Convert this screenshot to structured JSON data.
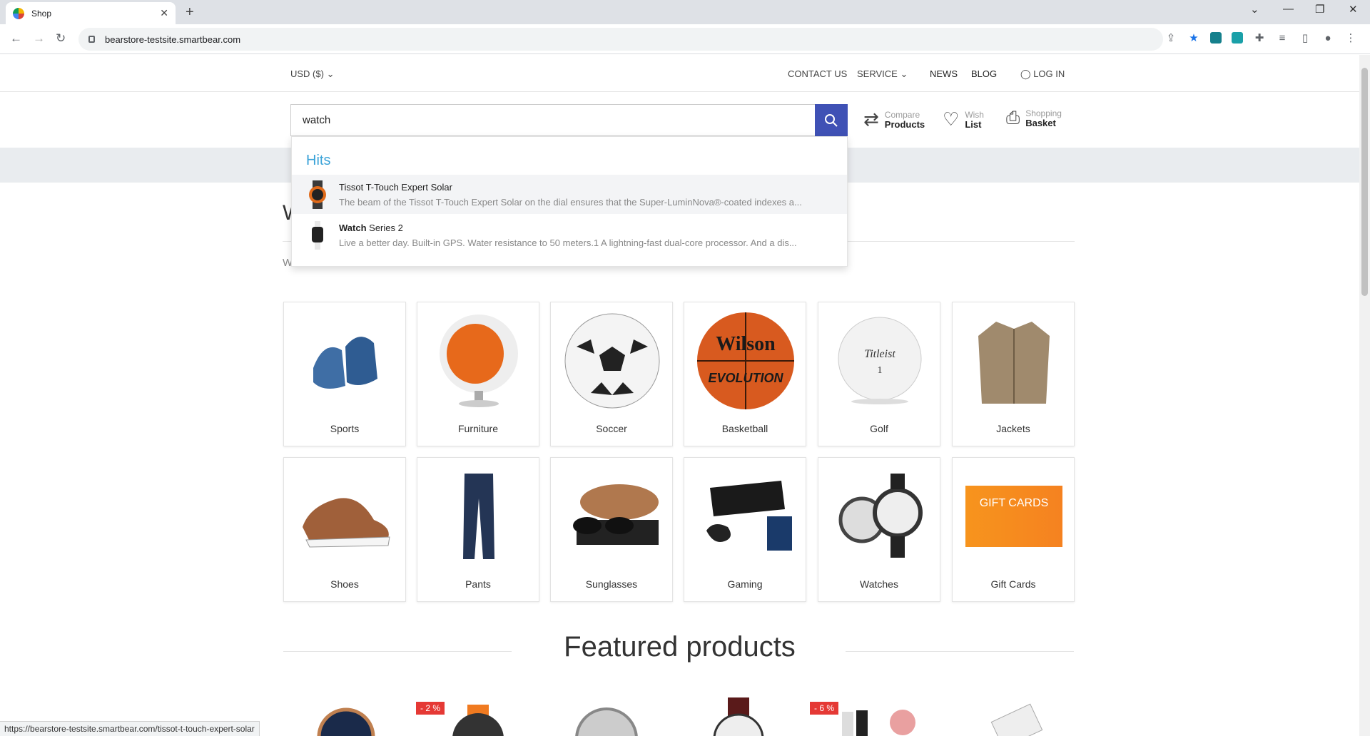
{
  "browser": {
    "tab_title": "Shop",
    "url": "bearstore-testsite.smartbear.com",
    "status_url": "https://bearstore-testsite.smartbear.com/tissot-t-touch-expert-solar"
  },
  "header": {
    "currency": "USD ($)",
    "nav": {
      "contact": "CONTACT US",
      "service": "SERVICE",
      "news": "NEWS",
      "blog": "BLOG",
      "login": "LOG IN"
    },
    "search_value": "watch",
    "tools": {
      "compare_small": "Compare",
      "compare_big": "Products",
      "wish_small": "Wish",
      "wish_big": "List",
      "basket_small": "Shopping",
      "basket_big": "Basket"
    }
  },
  "search_dropdown": {
    "heading": "Hits",
    "results": [
      {
        "name": "Tissot T-Touch Expert Solar",
        "description": "The beam of the Tissot T-Touch Expert Solar on the dial ensures that the Super-LuminNova®-coated indexes a..."
      },
      {
        "name_highlight": "Watch",
        "name_rest": " Series 2",
        "description": "Live a better day. Built-in GPS. Water resistance to 50 meters.1 A lightning-fast dual-core processor. And a dis..."
      }
    ]
  },
  "categories": [
    {
      "label": "Sports"
    },
    {
      "label": "Furniture"
    },
    {
      "label": "Soccer"
    },
    {
      "label": "Basketball"
    },
    {
      "label": "Golf"
    },
    {
      "label": "Jackets"
    },
    {
      "label": "Shoes"
    },
    {
      "label": "Pants"
    },
    {
      "label": "Sunglasses"
    },
    {
      "label": "Gaming"
    },
    {
      "label": "Watches"
    },
    {
      "label": "Gift Cards"
    }
  ],
  "giftcard_text": "GIFT CARDS",
  "basketball_brand": "Wilson",
  "basketball_model": "EVOLUTION",
  "featured_title": "Featured products",
  "badges": [
    "- 2 %",
    "- 6 %"
  ],
  "colors": {
    "accent": "#3f51b5",
    "hits": "#3ba3d8",
    "badge": "#e53935"
  }
}
